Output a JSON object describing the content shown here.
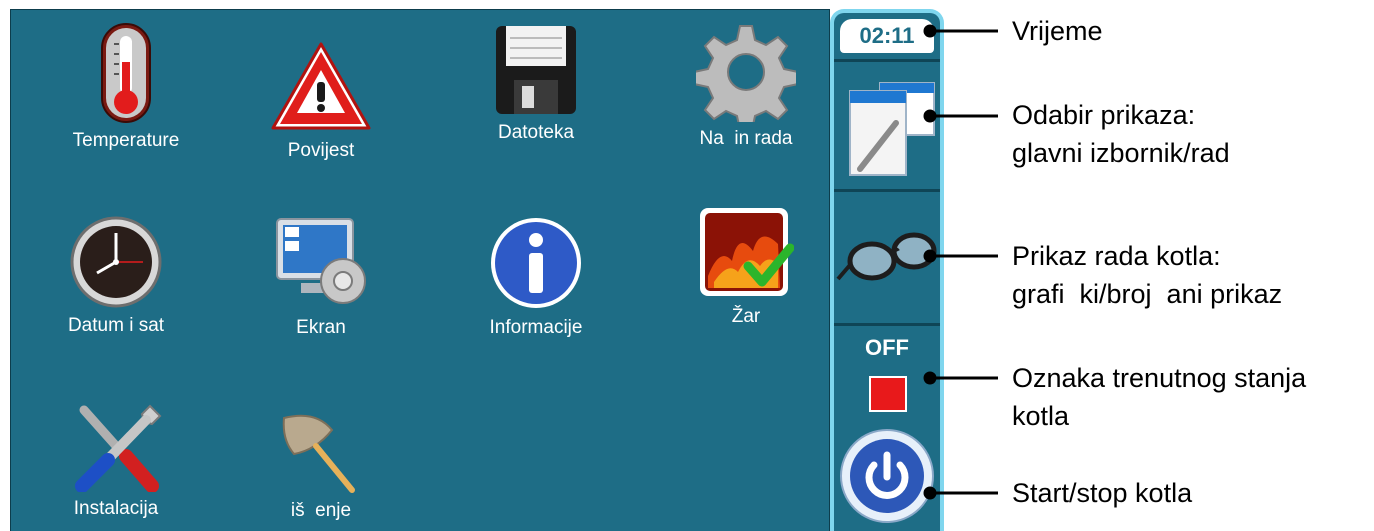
{
  "apps": [
    {
      "name": "tile-temperature",
      "label": "Temperature",
      "icon": "thermometer-icon"
    },
    {
      "name": "tile-povijest",
      "label": "Povijest",
      "icon": "warning-icon"
    },
    {
      "name": "tile-datoteka",
      "label": "Datoteka",
      "icon": "floppy-disk-icon"
    },
    {
      "name": "tile-nacin-rada",
      "label": "Na  in rada",
      "icon": "gear-icon"
    },
    {
      "name": "tile-datum-i-sat",
      "label": "Datum i sat",
      "icon": "clock-icon"
    },
    {
      "name": "tile-ekran",
      "label": "Ekran",
      "icon": "monitor-settings-icon"
    },
    {
      "name": "tile-informacije",
      "label": "Informacije",
      "icon": "info-icon"
    },
    {
      "name": "tile-zar",
      "label": "Žar",
      "icon": "fire-check-icon"
    },
    {
      "name": "tile-instalacija",
      "label": "Instalacija",
      "icon": "tools-icon"
    },
    {
      "name": "tile-ciscenje",
      "label": "iš  enje",
      "icon": "duster-icon"
    }
  ],
  "side": {
    "time": "02:11",
    "state": "OFF",
    "state_color": "#e8191b",
    "view_select_icon": "menu-pages-icon",
    "work_view_icon": "glasses-icon",
    "power_icon": "power-button-icon"
  },
  "annotations": {
    "time": "Vrijeme",
    "view_select": "Odabir prikaza:\nglavni izbornik/rad",
    "work_view": "Prikaz rada kotla:\ngrafi  ki/broj  ani prikaz",
    "state": "Oznaka trenutnog stanja\nkotla",
    "start_stop": "Start/stop kotla"
  },
  "colors": {
    "screen": "#1e6d86",
    "panel_border": "#7fd6ee",
    "text": "#ffffff"
  }
}
